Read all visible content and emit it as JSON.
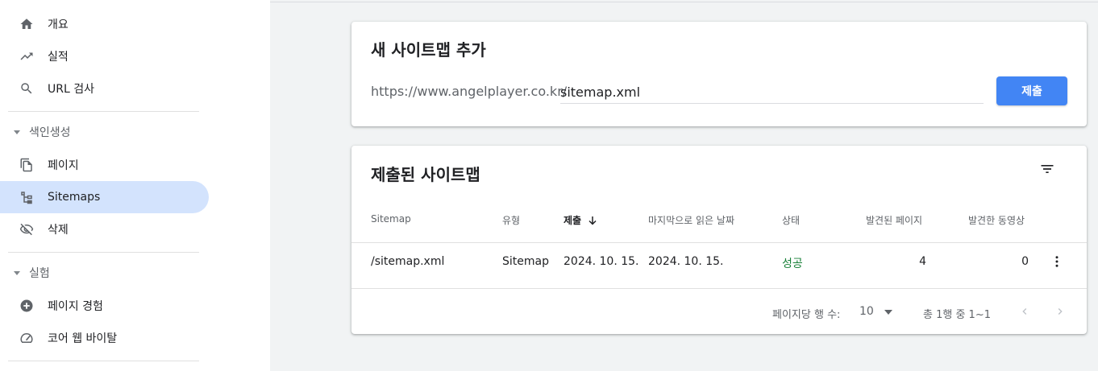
{
  "sidebar": {
    "nav_top": [
      {
        "label": "개요",
        "icon": "home-icon"
      },
      {
        "label": "실적",
        "icon": "trending-up-icon"
      },
      {
        "label": "URL 검사",
        "icon": "search-icon"
      }
    ],
    "indexing": {
      "label": "색인생성",
      "items": [
        {
          "label": "페이지",
          "icon": "pages-icon"
        },
        {
          "label": "Sitemaps",
          "icon": "sitemap-icon",
          "active": true
        },
        {
          "label": "삭제",
          "icon": "eye-off-icon"
        }
      ]
    },
    "experience": {
      "label": "실험",
      "items": [
        {
          "label": "페이지 경험",
          "icon": "add-circle-icon"
        },
        {
          "label": "코어 웹 바이탈",
          "icon": "speed-gauge-icon"
        }
      ]
    }
  },
  "add_card": {
    "title": "새 사이트맵 추가",
    "url_prefix": "https://www.angelplayer.co.kr/",
    "input_value": "sitemap.xml",
    "submit_label": "제출"
  },
  "list_card": {
    "title": "제출된 사이트맵",
    "columns": [
      "Sitemap",
      "유형",
      "제출",
      "마지막으로 읽은 날짜",
      "상태",
      "발견된 페이지",
      "발견한 동영상"
    ],
    "sorted_column": "제출",
    "rows": [
      {
        "sitemap": "/sitemap.xml",
        "type": "Sitemap",
        "submitted": "2024. 10. 15.",
        "last_read": "2024. 10. 15.",
        "status": "성공",
        "pages": "4",
        "videos": "0"
      }
    ],
    "pagination": {
      "rows_per_page_label": "페이지당 행 수:",
      "rows_per_page": "10",
      "range_text": "총 1행 중 1~1"
    }
  },
  "colors": {
    "accent": "#4285f4",
    "active_nav_bg": "#d3e3fd",
    "success": "#188038"
  }
}
